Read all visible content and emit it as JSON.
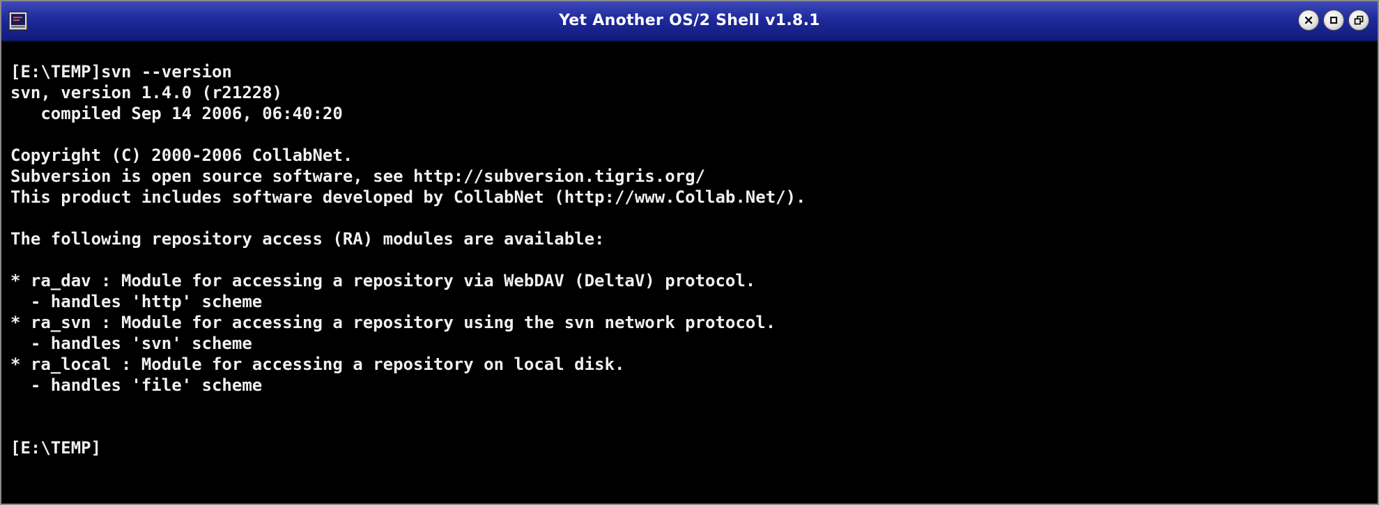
{
  "window": {
    "title": "Yet Another OS/2 Shell v1.8.1",
    "icon": "terminal-window-icon",
    "buttons": [
      {
        "name": "close",
        "icon": "close-icon"
      },
      {
        "name": "minimize",
        "icon": "minimize-icon"
      },
      {
        "name": "restore",
        "icon": "restore-icon"
      }
    ]
  },
  "terminal": {
    "background": "#000000",
    "foreground": "#f0f0f0",
    "lines": [
      "[E:\\TEMP]svn --version",
      "svn, version 1.4.0 (r21228)",
      "   compiled Sep 14 2006, 06:40:20",
      "",
      "Copyright (C) 2000-2006 CollabNet.",
      "Subversion is open source software, see http://subversion.tigris.org/",
      "This product includes software developed by CollabNet (http://www.Collab.Net/).",
      "",
      "The following repository access (RA) modules are available:",
      "",
      "* ra_dav : Module for accessing a repository via WebDAV (DeltaV) protocol.",
      "  - handles 'http' scheme",
      "* ra_svn : Module for accessing a repository using the svn network protocol.",
      "  - handles 'svn' scheme",
      "* ra_local : Module for accessing a repository on local disk.",
      "  - handles 'file' scheme",
      "",
      "",
      "[E:\\TEMP]"
    ]
  },
  "colors": {
    "titlebar": "#1e2a9c",
    "title_text": "#ffffff"
  }
}
